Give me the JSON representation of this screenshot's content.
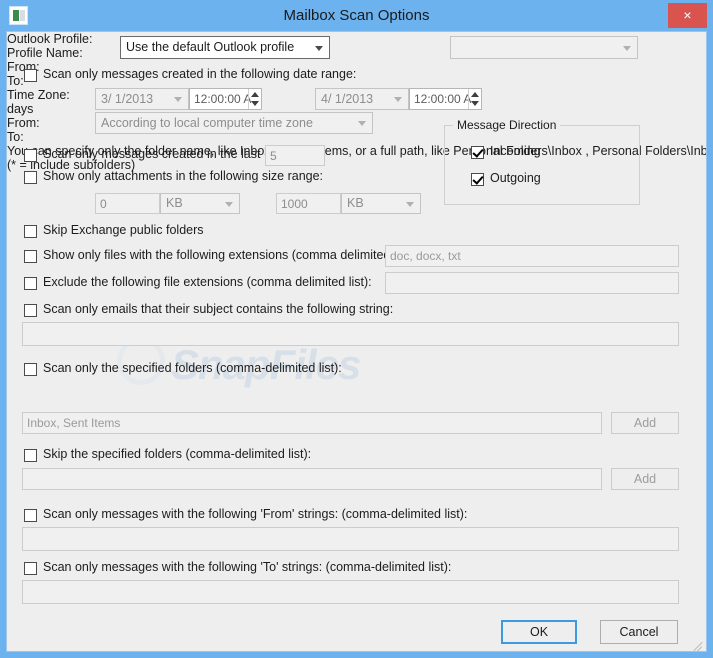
{
  "window": {
    "title": "Mailbox Scan Options",
    "app_icon": "mailbox-app-icon",
    "close_label": "×",
    "watermark": "SnapFiles"
  },
  "profile": {
    "outlook_profile_label": "Outlook Profile:",
    "outlook_profile_value": "Use the default Outlook profile",
    "profile_name_label": "Profile Name:",
    "profile_name_value": ""
  },
  "date_range": {
    "checkbox_label": "Scan only messages created in the following date range:",
    "checked": false,
    "from_label": "From:",
    "from_date": "3/  1/2013",
    "from_time": "12:00:00 A",
    "to_label": "To:",
    "to_date": "4/  1/2013",
    "to_time": "12:00:00 A",
    "timezone_label": "Time Zone:",
    "timezone_value": "According to local computer time zone"
  },
  "last_days": {
    "checkbox_label": "Scan only messages created in the last",
    "checked": false,
    "value": "5",
    "unit_label": "days"
  },
  "size_range": {
    "checkbox_label": "Show only attachments in the following size range:",
    "checked": false,
    "from_label": "From:",
    "from_value": "0",
    "from_unit": "KB",
    "to_label": "To:",
    "to_value": "1000",
    "to_unit": "KB"
  },
  "message_direction": {
    "group_title": "Message Direction",
    "incoming_label": "Incoming",
    "incoming_checked": true,
    "outgoing_label": "Outgoing",
    "outgoing_checked": true
  },
  "skip_public": {
    "checkbox_label": "Skip Exchange public folders",
    "checked": false
  },
  "include_extensions": {
    "checkbox_label": "Show only files with the following extensions (comma delimited list):",
    "checked": false,
    "value": "doc, docx, txt"
  },
  "exclude_extensions": {
    "checkbox_label": "Exclude the following file extensions (comma delimited list):",
    "checked": false,
    "value": ""
  },
  "subject_filter": {
    "checkbox_label": "Scan only emails that their subject contains the following string:",
    "checked": false,
    "value": ""
  },
  "only_folders": {
    "checkbox_label": "Scan only the specified folders (comma-delimited list):",
    "checked": false,
    "hint_line1": "You can specify only the folder name, like Inbox or Sent Items, or a full path, like Personal Folders\\Inbox , Personal Folders\\Inbox*",
    "hint_line2": "(* = include subfolders)",
    "value": "Inbox, Sent Items",
    "add_label": "Add"
  },
  "skip_folders": {
    "checkbox_label": "Skip the specified folders (comma-delimited list):",
    "checked": false,
    "value": "",
    "add_label": "Add"
  },
  "from_strings": {
    "checkbox_label": "Scan only messages with the following 'From' strings: (comma-delimited list):",
    "checked": false,
    "value": ""
  },
  "to_strings": {
    "checkbox_label": "Scan only messages with the following 'To' strings: (comma-delimited list):",
    "checked": false,
    "value": ""
  },
  "footer": {
    "ok_label": "OK",
    "cancel_label": "Cancel"
  },
  "colors": {
    "titlebar": "#6cb2ef",
    "close_button": "#d9534f",
    "client_bg": "#efeeee",
    "accent_focus": "#3c9ae0"
  }
}
